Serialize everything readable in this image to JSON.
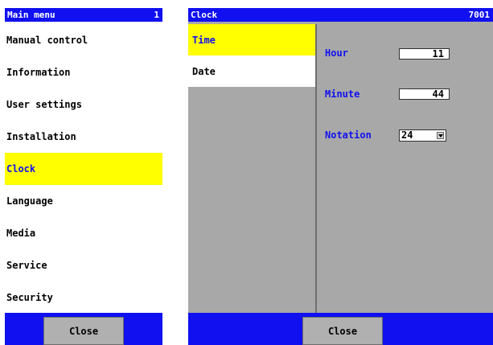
{
  "main_menu": {
    "title": "Main menu",
    "page_number": "1",
    "items": [
      {
        "label": "Manual control"
      },
      {
        "label": "Information"
      },
      {
        "label": "User settings"
      },
      {
        "label": "Installation"
      },
      {
        "label": "Clock",
        "selected": true
      },
      {
        "label": "Language"
      },
      {
        "label": "Media"
      },
      {
        "label": "Service"
      },
      {
        "label": "Security"
      }
    ],
    "close_label": "Close"
  },
  "clock_panel": {
    "title": "Clock",
    "code": "7001",
    "tabs": [
      {
        "label": "Time",
        "selected": true
      },
      {
        "label": "Date"
      }
    ],
    "fields": {
      "hour": {
        "label": "Hour",
        "value": "11"
      },
      "minute": {
        "label": "Minute",
        "value": "44"
      },
      "notation": {
        "label": "Notation",
        "value": "24"
      }
    },
    "close_label": "Close"
  },
  "colors": {
    "title_bar": "#1010f0",
    "selection": "#ffff00",
    "panel_bg": "#a8a8a8"
  }
}
